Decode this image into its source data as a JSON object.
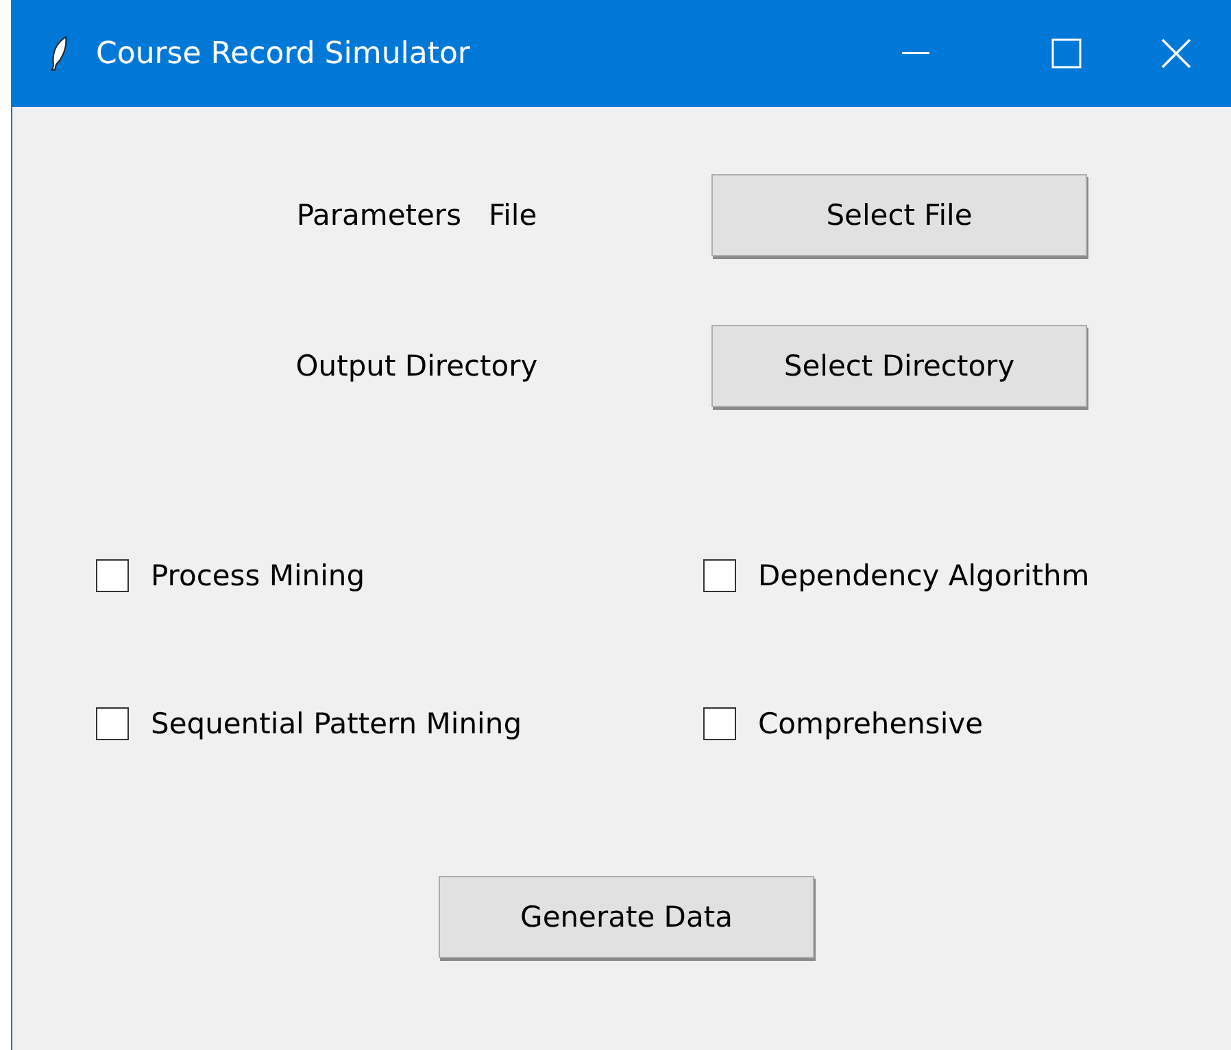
{
  "window": {
    "title": "Course Record Simulator"
  },
  "file_rows": [
    {
      "label": "Parameters   File",
      "button": "Select File"
    },
    {
      "label": "Output Directory",
      "button": "Select Directory"
    }
  ],
  "options": [
    {
      "label": "Process Mining",
      "checked": false
    },
    {
      "label": "Dependency Algorithm",
      "checked": false
    },
    {
      "label": "Sequential Pattern Mining",
      "checked": false
    },
    {
      "label": "Comprehensive",
      "checked": false
    }
  ],
  "generate_button": "Generate Data"
}
